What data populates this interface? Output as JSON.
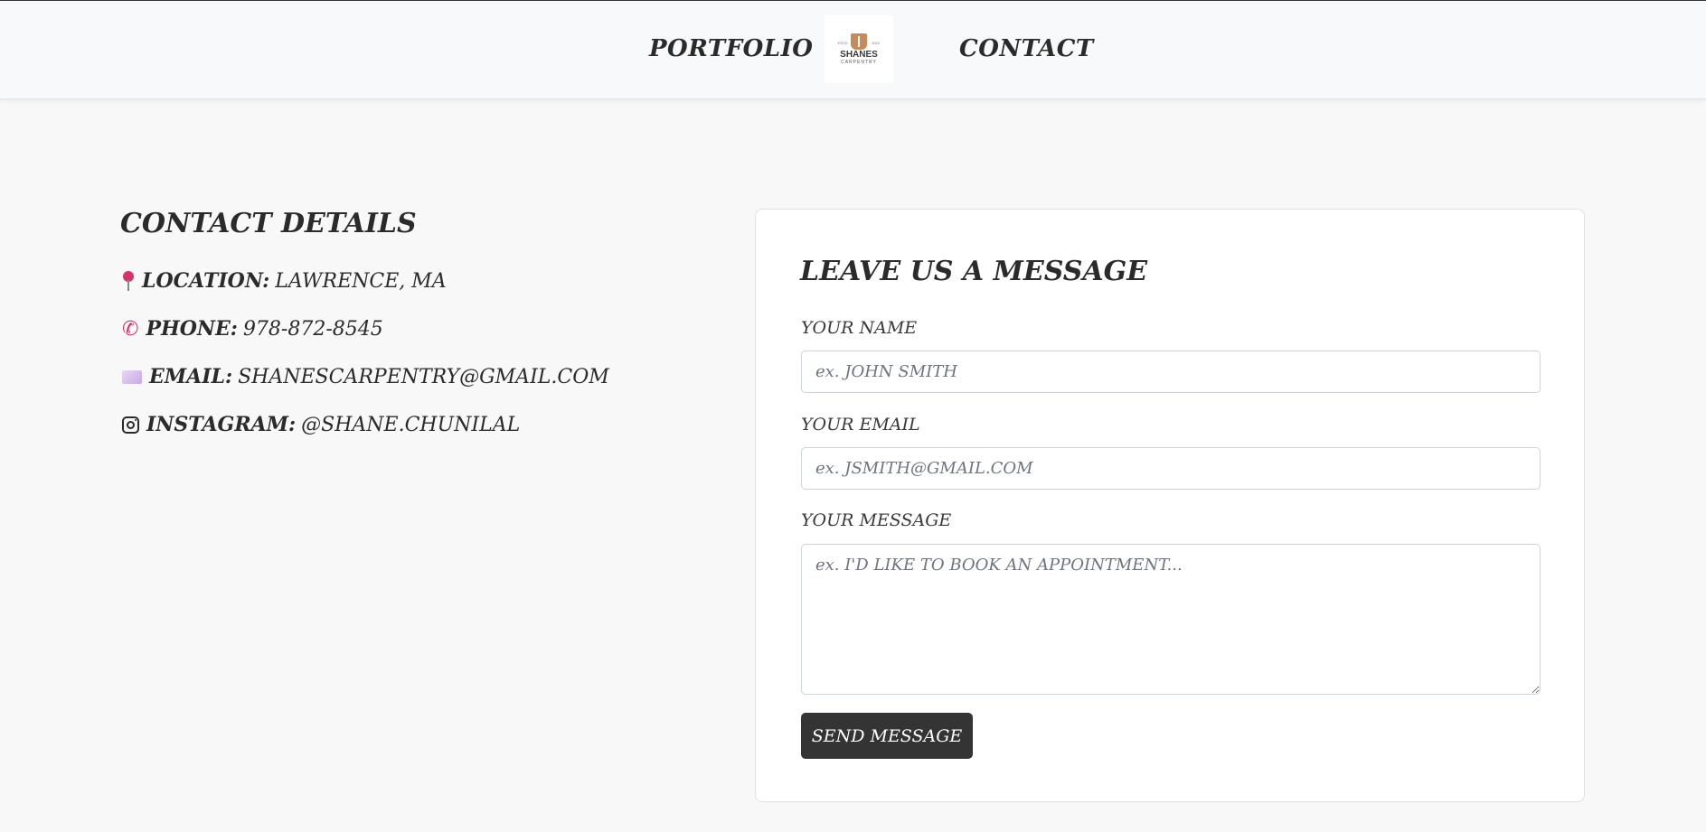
{
  "nav": {
    "portfolio_label": "PORTFOLIO",
    "contact_label": "CONTACT",
    "logo": {
      "name": "SHANES",
      "sub": "CARPENTRY",
      "est_left": "ESTD",
      "est_right": "2022"
    }
  },
  "details": {
    "title": "CONTACT DETAILS",
    "rows": [
      {
        "icon": "location-pin-icon",
        "label": "LOCATION:",
        "value": "LAWRENCE, MA"
      },
      {
        "icon": "phone-icon",
        "label": "PHONE:",
        "value": "978-872-8545"
      },
      {
        "icon": "envelope-icon",
        "label": "EMAIL:",
        "value": "SHANESCARPENTRY@GMAIL.COM"
      },
      {
        "icon": "instagram-icon",
        "label": "INSTAGRAM:",
        "value": "@SHANE.CHUNILAL"
      }
    ]
  },
  "form": {
    "title": "LEAVE US A MESSAGE",
    "name_label": "YOUR NAME",
    "name_placeholder": "ex. JOHN SMITH",
    "email_label": "YOUR EMAIL",
    "email_placeholder": "ex. JSMITH@GMAIL.COM",
    "message_label": "YOUR MESSAGE",
    "message_placeholder": "ex. I'D LIKE TO BOOK AN APPOINTMENT...",
    "send_label": "SEND MESSAGE"
  },
  "colors": {
    "accent_pink": "#d6336c",
    "button_dark": "#343434",
    "background": "#f8f8f8"
  }
}
